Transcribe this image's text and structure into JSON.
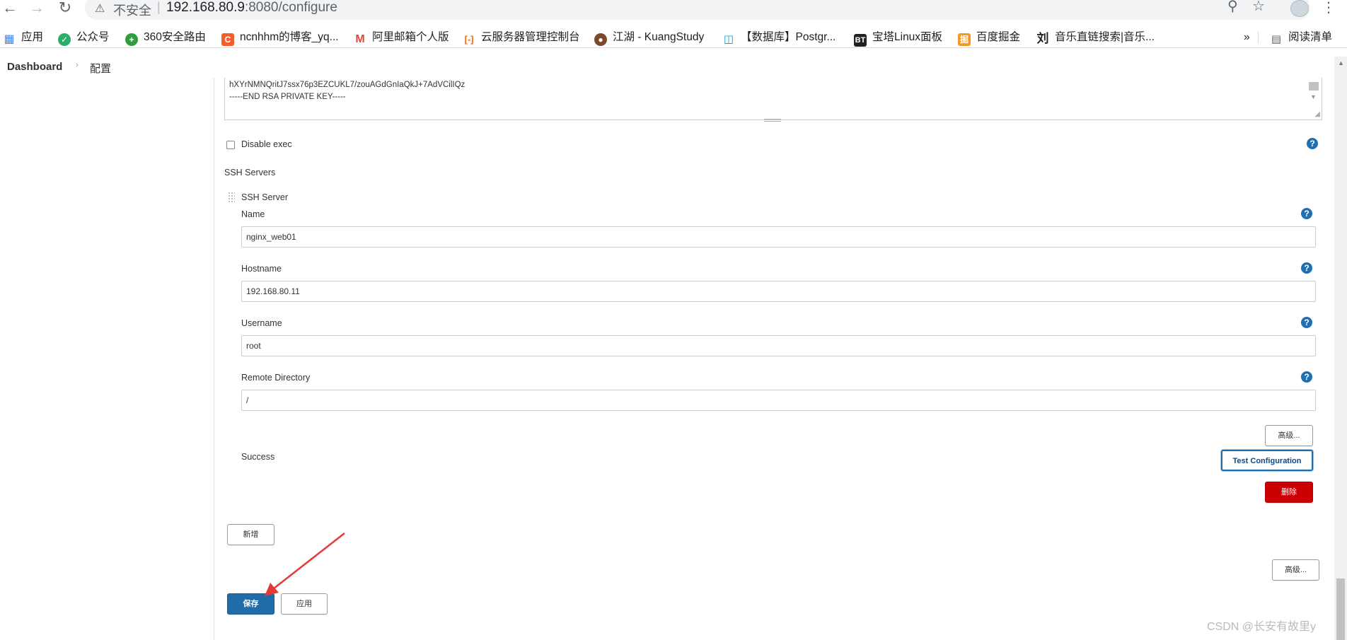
{
  "browser": {
    "insecure_label": "不安全",
    "url_host": "192.168.80.9",
    "url_rest": ":8080/configure",
    "separator": "|"
  },
  "bookmarks": [
    {
      "label": "应用",
      "icon": "apps-grid-icon",
      "color": "#4285f4"
    },
    {
      "label": "公众号",
      "icon": "wechat-icon",
      "color": "#2bae67"
    },
    {
      "label": "360安全路由",
      "icon": "360-icon",
      "color": "#2e9e3e"
    },
    {
      "label": "ncnhhm的博客_yq...",
      "icon": "csdn-icon",
      "color": "#f55d2c"
    },
    {
      "label": "阿里邮箱个人版",
      "icon": "aliyun-mail-icon",
      "color": "#e8453c"
    },
    {
      "label": "云服务器管理控制台",
      "icon": "aliyun-icon",
      "color": "#ff6a00"
    },
    {
      "label": "江湖 - KuangStudy",
      "icon": "kuangstudy-icon",
      "color": "#7b4a2e"
    },
    {
      "label": "【数据库】Postgr...",
      "icon": "bilibili-icon",
      "color": "#00a1d6"
    },
    {
      "label": "宝塔Linux面板",
      "icon": "bt-icon",
      "color": "#222222"
    },
    {
      "label": "百度掘金",
      "icon": "juejin-icon",
      "color": "#f29a1f"
    },
    {
      "label": "音乐直链搜索|音乐...",
      "icon": "liu-icon",
      "color": "#222222"
    }
  ],
  "bookmarks_more": "»",
  "reading_list": "阅读清单",
  "breadcrumb": {
    "dashboard": "Dashboard",
    "separator": "›",
    "current": "配置"
  },
  "key": {
    "line1": "hXYrNMNQritJ7ssx76p3EZCUKL7/zouAGdGnIaQkJ+7AdVCilIQz",
    "line2": "-----END RSA PRIVATE KEY-----"
  },
  "disable_exec_label": "Disable exec",
  "ssh_servers_label": "SSH Servers",
  "ssh_server_label": "SSH Server",
  "fields": {
    "name": {
      "label": "Name",
      "value": "nginx_web01"
    },
    "hostname": {
      "label": "Hostname",
      "value": "192.168.80.11"
    },
    "username": {
      "label": "Username",
      "value": "root"
    },
    "remote_dir": {
      "label": "Remote Directory",
      "value": "/"
    }
  },
  "advanced_label": "高级...",
  "success_text": "Success",
  "test_config_label": "Test Configuration",
  "delete_label": "删除",
  "add_label": "新增",
  "advanced2_label": "高级...",
  "save_label": "保存",
  "apply_label": "应用",
  "help_glyph": "?",
  "watermark": "CSDN @长安有故里y",
  "colors": {
    "primary": "#206ca9",
    "danger": "#cc0003",
    "annotation": "#e53935"
  }
}
